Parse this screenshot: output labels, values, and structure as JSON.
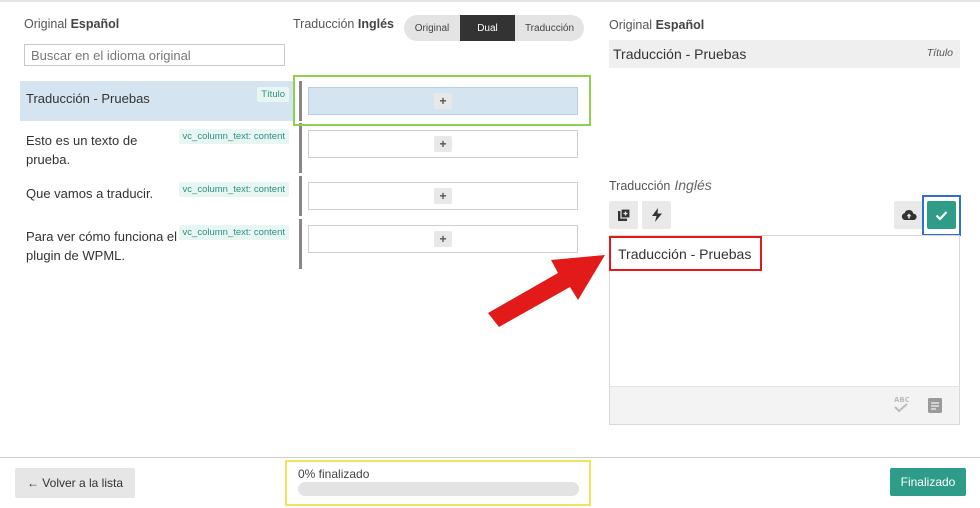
{
  "source_column": {
    "label": "Original",
    "language": "Español",
    "search_placeholder": "Buscar en el idioma original"
  },
  "target_column": {
    "label": "Traducción",
    "language": "Inglés"
  },
  "view_toggle": {
    "options": [
      "Original",
      "Dual",
      "Traducción"
    ],
    "selected": "Dual"
  },
  "rows": [
    {
      "text": "Traducción - Pruebas",
      "tag": "Título",
      "translation": "",
      "active": true
    },
    {
      "text": "Esto es un texto de prueba.",
      "tag": "vc_column_text: content",
      "translation": "",
      "active": false
    },
    {
      "text": "Que vamos a traducir.",
      "tag": "vc_column_text: content",
      "translation": "",
      "active": false
    },
    {
      "text": "Para ver cómo funciona el plugin de WPML.",
      "tag": "vc_column_text: content",
      "translation": "",
      "active": false
    }
  ],
  "editor": {
    "original_label": "Original",
    "original_language": "Español",
    "original_text": "Traducción - Pruebas",
    "original_field": "Título",
    "translation_label": "Traducción",
    "translation_language": "Inglés",
    "translation_text": "Traducción - Pruebas",
    "tools": [
      "copy-icon",
      "lightning-icon",
      "cloud-upload-icon",
      "checkmark-icon"
    ],
    "footer_tools": [
      "spellcheck-icon",
      "glossary-icon"
    ]
  },
  "footer": {
    "back_label": "← Volver a la lista",
    "progress_label": "0% finalizado",
    "progress_percent": 0,
    "done_label": "Finalizado"
  },
  "colors": {
    "accent": "#2e9c88",
    "active_row": "#d4e4f0",
    "highlight_green": "#8fd14f",
    "highlight_blue": "#2f6fd0",
    "highlight_red": "#e21a1a",
    "highlight_yellow": "#f2e45a",
    "arrow": "#e21a1a"
  }
}
